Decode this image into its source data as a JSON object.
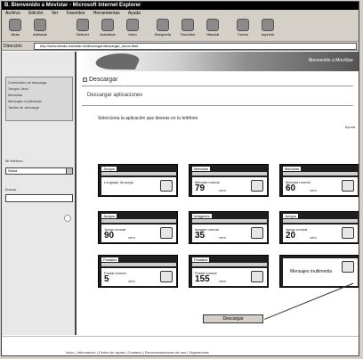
{
  "window": {
    "title": "B. Bienvenido a Movistar - Microsoft Internet Explorer"
  },
  "menu": [
    "Archivo",
    "Edición",
    "Ver",
    "Favoritos",
    "Herramientas",
    "Ayuda"
  ],
  "toolbar": [
    {
      "icon": "back-icon",
      "label": "Atrás"
    },
    {
      "icon": "forward-icon",
      "label": "Adelante"
    },
    {
      "icon": "stop-icon",
      "label": "Detener"
    },
    {
      "icon": "refresh-icon",
      "label": "Actualizar"
    },
    {
      "icon": "home-icon",
      "label": "Inicio"
    },
    {
      "icon": "search-icon",
      "label": "Búsqueda"
    },
    {
      "icon": "favorites-icon",
      "label": "Favoritos"
    },
    {
      "icon": "history-icon",
      "label": "Historial"
    },
    {
      "icon": "mail-icon",
      "label": "Correo"
    },
    {
      "icon": "print-icon",
      "label": "Imprimir"
    }
  ],
  "address": {
    "label": "Dirección",
    "url": "http://www.tienda.movistar.es/descargar/descargar_tonos.html"
  },
  "sidebar": {
    "links": [
      "Contenidos de descarga",
      "Juegos Java",
      "Melodías",
      "Mensajes multimedia",
      "Tarifas de descarga"
    ],
    "select_heading": "Mi teléfono",
    "select_value": "Nokia",
    "input_heading": "Buscar"
  },
  "banner": {
    "text": "Bienvenido a MoviStar"
  },
  "page": {
    "section_title": "Descargar",
    "subtitle": "Descargar aplicaciones",
    "instruction": "Selecciona la aplicación que deseas en tu teléfono",
    "mini_link": "Ayuda",
    "submit_label": "Descargar"
  },
  "cards": [
    {
      "tag": "Juegos",
      "label": "Lenguaje de juego",
      "big": "",
      "unit": "",
      "icon": "game-icon"
    },
    {
      "tag": "Melodías",
      "label": "Melodía normal",
      "big": "79",
      "unit": "cént.",
      "icon": "phone-icon"
    },
    {
      "tag": "Melodías",
      "label": "Melodía normal",
      "big": "60",
      "unit": "cént.",
      "icon": "phone-icon"
    },
    {
      "tag": "Juegos",
      "label": "Juego normal",
      "big": "90",
      "unit": "cént.",
      "icon": "game-icon"
    },
    {
      "tag": "Imágenes",
      "label": "Imagen normal",
      "big": "35",
      "unit": "cént.",
      "icon": "image-icon"
    },
    {
      "tag": "Juegos",
      "label": "Juego normal",
      "big": "20",
      "unit": "cént.",
      "icon": "game-icon"
    },
    {
      "tag": "Postales",
      "label": "Postal normal",
      "big": "5",
      "unit": "cént.",
      "icon": "card-icon"
    },
    {
      "tag": "Postales",
      "label": "Postal normal",
      "big": "155",
      "unit": "cént.",
      "icon": "card-icon"
    },
    {
      "tag": "",
      "label": "Mensajes multimedia",
      "big": "",
      "unit": "",
      "icon": "mms-icon"
    }
  ],
  "footer": {
    "links": "Inicio | Información | Centro de ayuda | Contacto | Recomendaciones de uso | Sugerencias"
  },
  "colors": {
    "title_bar": "#000000",
    "chrome": "#d4d0c8",
    "card": "#1e1e1e"
  }
}
